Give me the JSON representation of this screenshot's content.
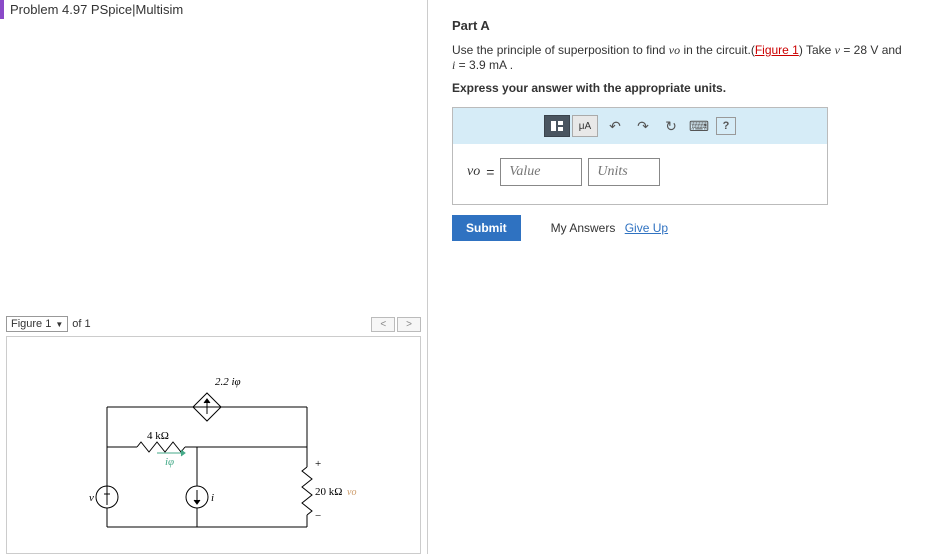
{
  "problem_title": "Problem 4.97 PSpice|Multisim",
  "figure": {
    "selector_label": "Figure 1",
    "of_text": "of 1",
    "prev": "<",
    "next": ">"
  },
  "circuit": {
    "dep_source_label": "2.2 iφ",
    "r1": "4 kΩ",
    "iphi": "iφ",
    "v_src": "v",
    "i_src": "i",
    "r2_label": "20 kΩ",
    "vo_label": "vo",
    "plus": "+",
    "minus": "−"
  },
  "part": {
    "title": "Part A",
    "prompt_prefix": "Use the principle of superposition to find ",
    "vo": "vo",
    "prompt_mid": " in the circuit.(",
    "figure_link": "Figure 1",
    "prompt_after_link": ") Take ",
    "v_var": "v",
    "v_eq": " = 28 ",
    "v_unit": "V",
    "and": " and ",
    "i_var": "i",
    "i_eq": " = 3.9 ",
    "i_unit": "mA",
    "period": " .",
    "instruction": "Express your answer with the appropriate units."
  },
  "toolbar": {
    "mu_a": "μA",
    "undo": "↶",
    "redo": "↷",
    "reset": "↻",
    "keyboard": "⌨",
    "help": "?"
  },
  "input": {
    "label": "vo",
    "eq": "=",
    "value_placeholder": "Value",
    "units_placeholder": "Units"
  },
  "actions": {
    "submit": "Submit",
    "my_answers": "My Answers",
    "give_up": "Give Up"
  }
}
